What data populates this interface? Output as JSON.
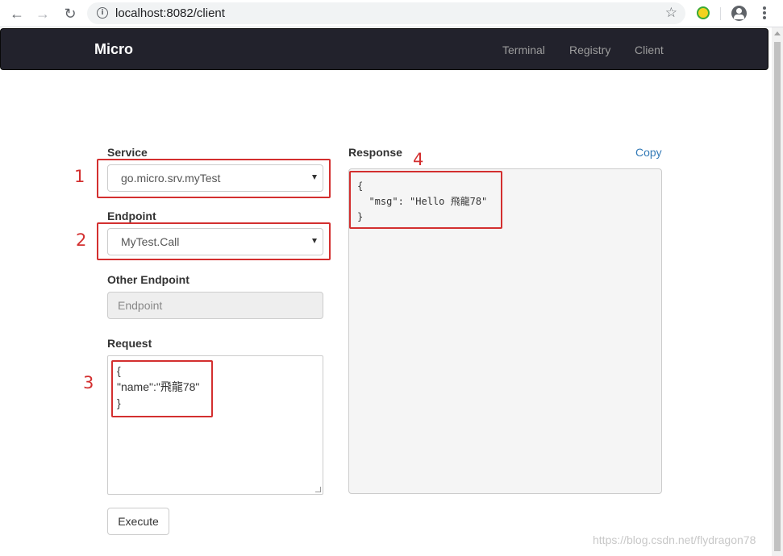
{
  "browser": {
    "url": "localhost:8082/client"
  },
  "navbar": {
    "brand": "Micro",
    "links": [
      "Terminal",
      "Registry",
      "Client"
    ]
  },
  "form": {
    "service": {
      "label": "Service",
      "selected": "go.micro.srv.myTest"
    },
    "endpoint": {
      "label": "Endpoint",
      "selected": "MyTest.Call"
    },
    "other_endpoint": {
      "label": "Other Endpoint",
      "placeholder": "Endpoint"
    },
    "request": {
      "label": "Request",
      "lines": [
        "{",
        "\"name\":\"飛龍78\"",
        "}"
      ]
    },
    "execute_label": "Execute"
  },
  "response": {
    "label": "Response",
    "copy_label": "Copy",
    "lines": [
      "{",
      "  \"msg\": \"Hello 飛龍78\"",
      "}"
    ]
  },
  "annotations": {
    "n1": "1",
    "n2": "2",
    "n3": "3",
    "n4": "4",
    "color": "#d32f2f"
  },
  "watermark": "https://blog.csdn.net/flydragon78",
  "colors": {
    "navbar_bg": "#22222c",
    "link": "#337ab7"
  }
}
